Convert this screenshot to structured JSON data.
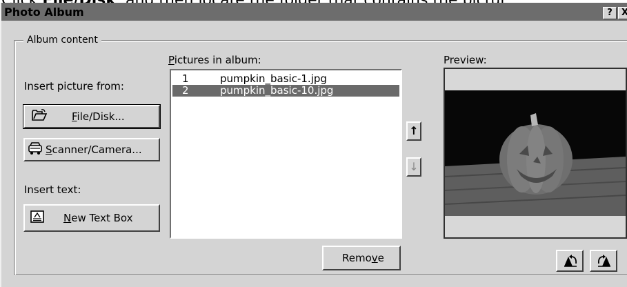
{
  "caption": {
    "before": "Click ",
    "bold": "File/Disk",
    "after": ", and then locate the folder that contains the pictur"
  },
  "window": {
    "title": "Photo Album",
    "help_label": "?",
    "close_label": "X"
  },
  "album_content": {
    "group_label": "Album content",
    "insert_picture_label": "Insert picture from:",
    "file_disk_button": {
      "mnemonic": "F",
      "rest": "ile/Disk..."
    },
    "scanner_button": {
      "mnemonic": "S",
      "rest": "canner/Camera..."
    },
    "insert_text_label": "Insert text:",
    "new_text_box_button": {
      "mnemonic": "N",
      "rest": "ew Text Box"
    }
  },
  "pictures": {
    "label_mnemonic": "P",
    "label_rest": "ictures in album:",
    "items": [
      {
        "num": "1",
        "name": "pumpkin_basic-1.jpg",
        "selected": false
      },
      {
        "num": "2",
        "name": "pumpkin_basic-10.jpg",
        "selected": true
      }
    ],
    "move_up_glyph": "↑",
    "move_down_glyph": "↓",
    "remove_button": {
      "before": "Remo",
      "mnemonic": "v",
      "after": "e"
    }
  },
  "preview": {
    "label": "Preview:"
  }
}
